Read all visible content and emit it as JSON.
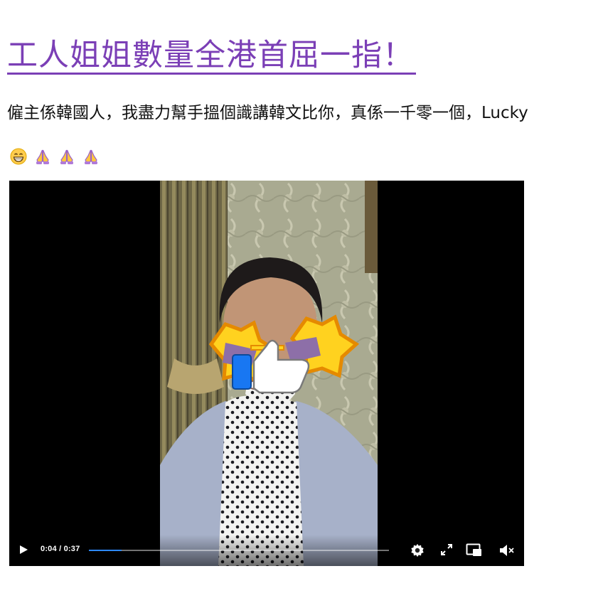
{
  "article": {
    "headline": "工人姐姐數量全港首屈一指！",
    "headline_color": "#7b3fb6",
    "body": "僱主係韓國人，我盡力幫手搵個識講韓文比你，真係一千零一個，Lucky",
    "emojis": [
      "grinning-face-icon",
      "folded-hands-icon",
      "folded-hands-icon",
      "folded-hands-icon"
    ]
  },
  "video": {
    "current_time": "0:04",
    "separator": " / ",
    "duration": "0:37",
    "progress": 0.108,
    "accent_color": "#2d88ff",
    "controls": [
      "play-icon",
      "settings-icon",
      "fullscreen-icon",
      "picture-in-picture-icon",
      "muted-icon"
    ],
    "overlay_sticker": "thumbs-up-star-glasses-sticker"
  }
}
